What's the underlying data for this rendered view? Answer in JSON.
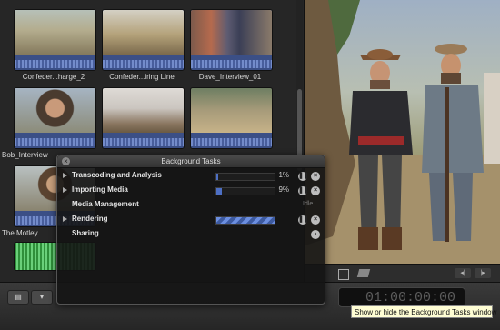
{
  "clips": [
    {
      "label": "Confeder...harge_2"
    },
    {
      "label": "Confeder...iring Line"
    },
    {
      "label": "Dave_Interview_01"
    },
    {
      "label": "Bob_Interview"
    },
    {
      "label": ""
    },
    {
      "label": ""
    },
    {
      "label": "The Motley"
    },
    {
      "label": ""
    }
  ],
  "background_tasks": {
    "title": "Background Tasks",
    "rows": [
      {
        "label": "Transcoding and Analysis",
        "percent_text": "1%",
        "progress": 0.01,
        "status": ""
      },
      {
        "label": "Importing Media",
        "percent_text": "9%",
        "progress": 0.09,
        "status": ""
      },
      {
        "label": "Media Management",
        "percent_text": "",
        "progress": 0,
        "status": "Idle"
      },
      {
        "label": "Rendering",
        "percent_text": "",
        "progress": 1.0,
        "status": ""
      },
      {
        "label": "Sharing",
        "percent_text": "",
        "progress": 0,
        "status": ""
      }
    ]
  },
  "timecode": "01:00:00:00",
  "tooltip": "Show or hide the Background Tasks window",
  "icons": {
    "close": "close-icon",
    "pause": "pause-icon",
    "cancel": "cancel-icon",
    "arrow": "arrow-right-icon",
    "disclosure": "disclosure-triangle-icon"
  },
  "colors": {
    "progress": "#4d6fc4",
    "tooltip_bg": "#fffed4"
  }
}
